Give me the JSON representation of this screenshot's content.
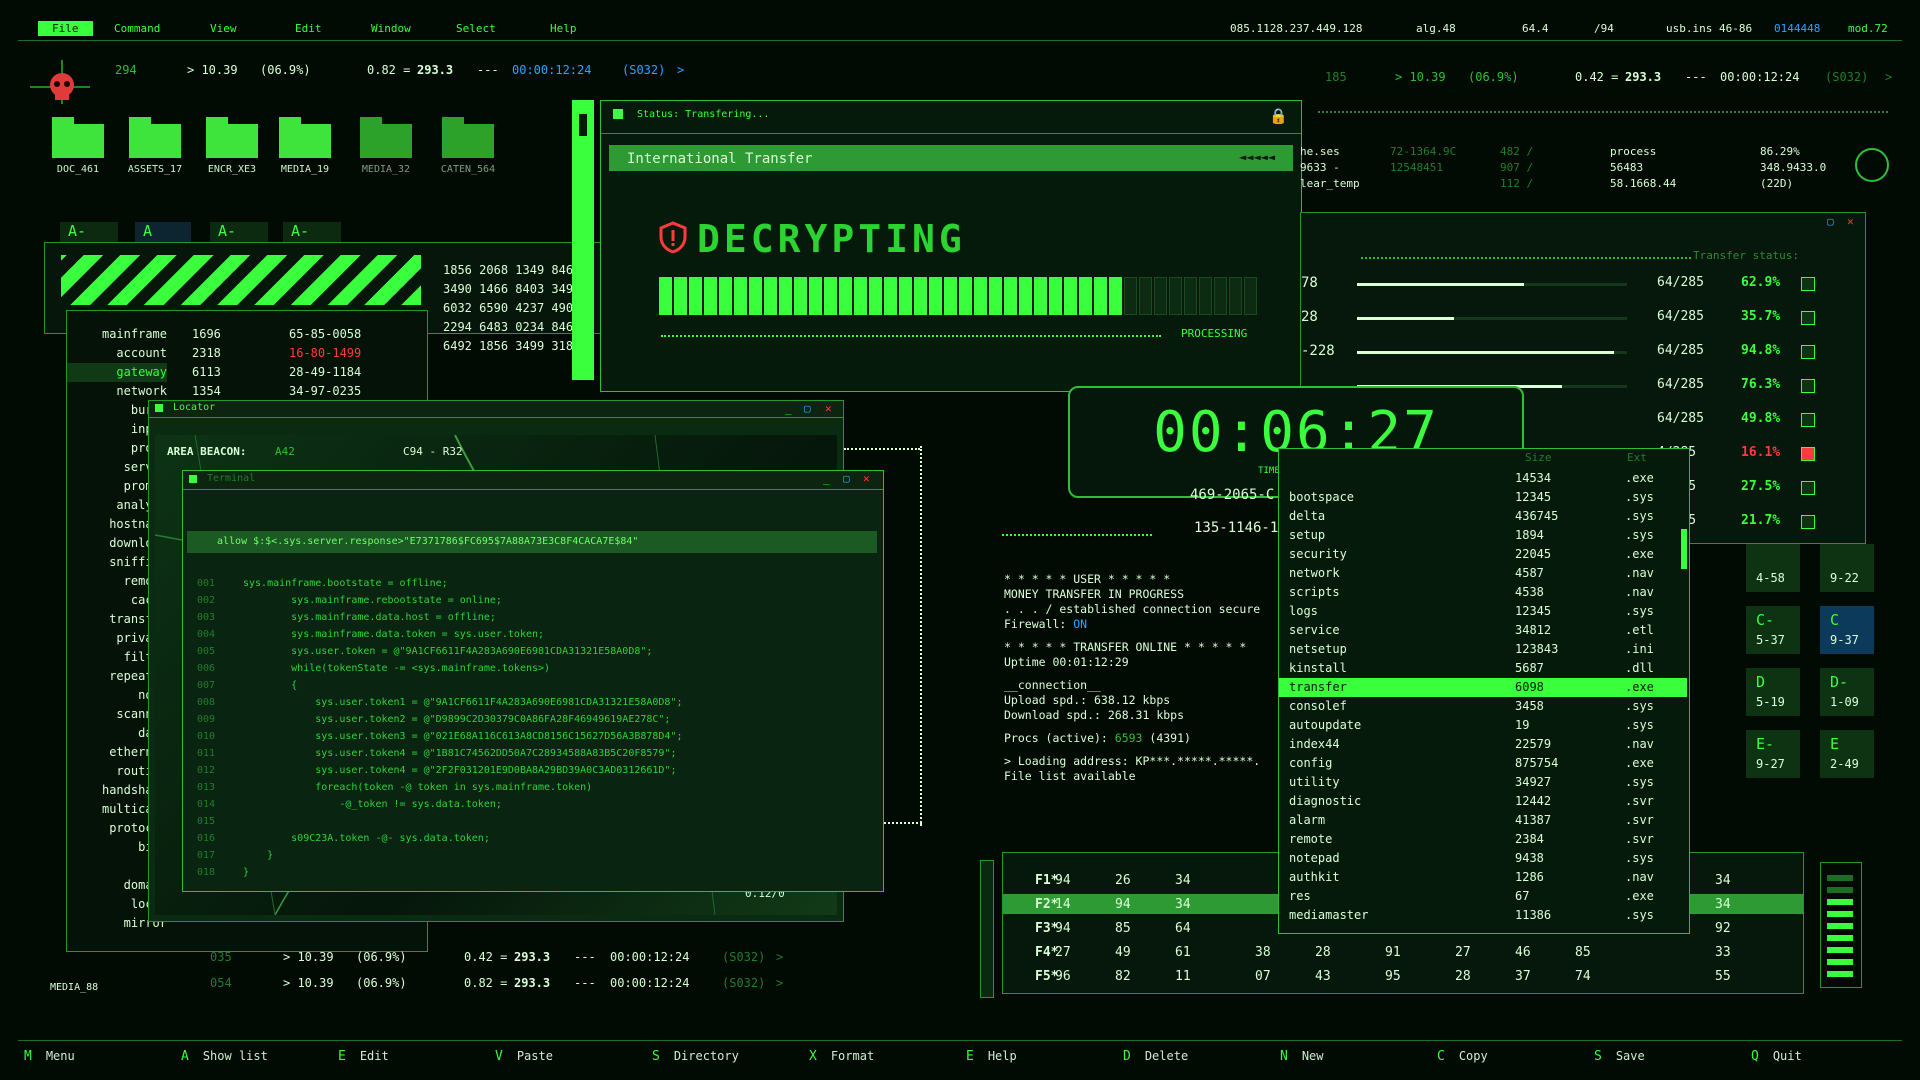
{
  "menubar": {
    "items": [
      "File",
      "Command",
      "View",
      "Edit",
      "Window",
      "Select",
      "Help"
    ],
    "right": [
      "085.1128.237.449.128",
      "alg.48",
      "64.4",
      "/94",
      "usb.ins 46-86",
      "0144448",
      "mod.72"
    ]
  },
  "header_left": {
    "num": "294",
    "val1": "> 10.39",
    "val2": "(06.9%)",
    "eq": "0.82 =",
    "eqval": "293.3",
    "sep": "---",
    "time": "00:00:12:24",
    "code": "(S032)",
    "arrow": ">"
  },
  "header_right": {
    "num": "185",
    "val1": "> 10.39",
    "val2": "(06.9%)",
    "eq": "0.42 =",
    "eqval": "293.3",
    "sep": "---",
    "time": "00:00:12:24",
    "code": "(S032)",
    "arrow": ">"
  },
  "folders": [
    "DOC_461",
    "ASSETS_17",
    "ENCR_XE3",
    "MEDIA_19",
    "MEDIA_32",
    "CATEN_564"
  ],
  "tabs": [
    "A-",
    "A",
    "A-",
    "A-"
  ],
  "numgrid": {
    "rows": [
      [
        "1856",
        "2068",
        "1349",
        "8460"
      ],
      [
        "3490",
        "1466",
        "8403",
        "3499"
      ],
      [
        "6032",
        "6590",
        "4237",
        "4903"
      ],
      [
        "2294",
        "6483",
        "0234",
        "8469"
      ],
      [
        "6492",
        "1856",
        "3499",
        "318"
      ]
    ]
  },
  "process_list": {
    "names": [
      "mainframe",
      "account",
      "gateway",
      "network",
      "burst",
      "input",
      "proxy",
      "server",
      "prompt",
      "analyze",
      "hostname",
      "download",
      "sniffing",
      "remote",
      "cache",
      "transfer",
      "privacy",
      "filter",
      "repeater",
      "node",
      "scanner",
      "data",
      "ethernet",
      "routing",
      "handshake",
      "multicast",
      "protocol",
      "bind",
      "ip",
      "domain",
      "local",
      "mirror"
    ],
    "col2": [
      "1696",
      "2318",
      "6113",
      "1354"
    ],
    "col3": [
      "65-85-0058",
      "16-80-1499",
      "28-49-1184",
      "34-97-0235"
    ]
  },
  "locator": {
    "title": "Locator",
    "beacon": "AREA BEACON:",
    "beacon_val": "A42",
    "coords": "C94 - R32",
    "foot": "0.12/0"
  },
  "terminal": {
    "title": "Terminal",
    "command": "allow $:$<.sys.server.response>\"E7371786$FC695$7A88A73E3C8F4CACA7E$84\"",
    "lines": [
      {
        "n": "001",
        "t": "sys.mainframe.bootstate = offline;"
      },
      {
        "n": "002",
        "t": "        sys.mainframe.rebootstate = online;"
      },
      {
        "n": "003",
        "t": "        sys.mainframe.data.host = offline;"
      },
      {
        "n": "004",
        "t": "        sys.mainframe.data.token = sys.user.token;"
      },
      {
        "n": "005",
        "t": "        sys.user.token = @\"9A1CF6611F4A283A690E6981CDA31321E58A0D8\";"
      },
      {
        "n": "006",
        "t": "        while(tokenState -= <sys.mainframe.tokens>)"
      },
      {
        "n": "007",
        "t": "        {"
      },
      {
        "n": "008",
        "t": "            sys.user.token1 = @\"9A1CF6611F4A283A690E6981CDA31321E58A0D8\";"
      },
      {
        "n": "009",
        "t": "            sys.user.token2 = @\"D9899C2D30379C0A86FA28F46949619AE278C\";"
      },
      {
        "n": "010",
        "t": "            sys.user.token3 = @\"021E68A116C613A8CD8156C15627D56A3B878D4\";"
      },
      {
        "n": "011",
        "t": "            sys.user.token4 = @\"1B81C74562DD50A7C28934588A83B5C20F8579\";"
      },
      {
        "n": "012",
        "t": "            sys.user.token4 = @\"2F2F031201E9D0BA8A29BD39A0C3AD0312661D\";"
      },
      {
        "n": "013",
        "t": "            foreach(token -@ token in sys.mainframe.token)"
      },
      {
        "n": "014",
        "t": "                -@_token != sys.data.token;"
      },
      {
        "n": "015",
        "t": ""
      },
      {
        "n": "016",
        "t": "        s09C23A.token -@- sys.data.token;"
      },
      {
        "n": "017",
        "t": "    }"
      },
      {
        "n": "018",
        "t": "}"
      }
    ]
  },
  "transfer_window": {
    "status": "Status: Transfering...",
    "title": "International Transfer",
    "arrows": "◄◄◄◄◄",
    "decrypting": "DECRYPTING",
    "progress": 0.77,
    "processing": "PROCESSING"
  },
  "timer": {
    "time": "00:06:27",
    "label": "TIME REMAINING"
  },
  "topright_info": {
    "c1": [
      "he.ses",
      "9633 -",
      "lear_temp"
    ],
    "c2": [
      "72-1364.9C",
      "12548451",
      ""
    ],
    "c3": [
      "482 /",
      "907 /",
      "112 /"
    ],
    "c4": [
      "process",
      "56483",
      "58.1668.44"
    ],
    "c5": [
      "86.29%",
      "348.9433.0",
      "(22D)"
    ]
  },
  "transfer_status": {
    "header": "Transfer status:",
    "left": [
      "78",
      "28",
      "-228",
      "",
      "",
      "",
      "",
      ""
    ],
    "rows": [
      {
        "ratio": "64/285",
        "pct": "62.9%",
        "red": false,
        "fill": 0.62
      },
      {
        "ratio": "64/285",
        "pct": "35.7%",
        "red": false,
        "fill": 0.36
      },
      {
        "ratio": "64/285",
        "pct": "94.8%",
        "red": false,
        "fill": 0.95
      },
      {
        "ratio": "64/285",
        "pct": "76.3%",
        "red": false,
        "fill": 0.76
      },
      {
        "ratio": "64/285",
        "pct": "49.8%",
        "red": false,
        "fill": 0.5
      },
      {
        "ratio": "4/285",
        "pct": "16.1%",
        "red": true,
        "fill": 0.16
      },
      {
        "ratio": "4/285",
        "pct": "27.5%",
        "red": false,
        "fill": 0.27
      },
      {
        "ratio": "4/285",
        "pct": "21.7%",
        "red": false,
        "fill": 0.22
      }
    ]
  },
  "ids": [
    "469-2065-C",
    "135-1146-1"
  ],
  "console": {
    "l1": "* * * * *  USER  * * * * *",
    "l2": "MONEY TRANSFER IN PROGRESS",
    "l3": ". . . / established connection secure",
    "l4a": "Firewall: ",
    "l4b": "ON",
    "l5": "* * * * * TRANSFER ONLINE * * * * *",
    "l6": "Uptime 00:01:12:29",
    "l7": "__connection__",
    "l8": "Upload spd.: 638.12 kbps",
    "l9": "Download spd.: 268.31 kbps",
    "l10a": "Procs (active): ",
    "l10b": "6593",
    "l10c": " (4391)",
    "l11": "> Loading address: KP***.*****.*****.",
    "l12": "File list available"
  },
  "filelist": {
    "hdr_size": "Size",
    "hdr_ext": "Ext",
    "rows": [
      {
        "name": "",
        "size": "14534",
        "ext": ".exe"
      },
      {
        "name": "bootspace",
        "size": "12345",
        "ext": ".sys"
      },
      {
        "name": "delta",
        "size": "436745",
        "ext": ".sys"
      },
      {
        "name": "setup",
        "size": "1894",
        "ext": ".sys"
      },
      {
        "name": "security",
        "size": "22045",
        "ext": ".exe"
      },
      {
        "name": "network",
        "size": "4587",
        "ext": ".nav"
      },
      {
        "name": "scripts",
        "size": "4538",
        "ext": ".nav"
      },
      {
        "name": "logs",
        "size": "12345",
        "ext": ".sys"
      },
      {
        "name": "service",
        "size": "34812",
        "ext": ".etl"
      },
      {
        "name": "netsetup",
        "size": "123843",
        "ext": ".ini"
      },
      {
        "name": "kinstall",
        "size": "5687",
        "ext": ".dll"
      },
      {
        "name": "transfer",
        "size": "6098",
        "ext": ".exe"
      },
      {
        "name": "consolef",
        "size": "3458",
        "ext": ".sys"
      },
      {
        "name": "autoupdate",
        "size": "19",
        "ext": ".sys"
      },
      {
        "name": "index44",
        "size": "22579",
        "ext": ".nav"
      },
      {
        "name": "config",
        "size": "875754",
        "ext": ".exe"
      },
      {
        "name": "utility",
        "size": "34927",
        "ext": ".sys"
      },
      {
        "name": "diagnostic",
        "size": "12442",
        "ext": ".svr"
      },
      {
        "name": "alarm",
        "size": "41387",
        "ext": ".svr"
      },
      {
        "name": "remote",
        "size": "2384",
        "ext": ".svr"
      },
      {
        "name": "notepad",
        "size": "9438",
        "ext": ".sys"
      },
      {
        "name": "authkit",
        "size": "1286",
        "ext": ".nav"
      },
      {
        "name": "res",
        "size": "67",
        "ext": ".exe"
      },
      {
        "name": "mediamaster",
        "size": "11386",
        "ext": ".sys"
      }
    ],
    "selected": 11
  },
  "fkeys": [
    {
      "k": "F1*",
      "v": [
        "94",
        "26",
        "34",
        "",
        "",
        "",
        "",
        "",
        "",
        "",
        "",
        "34"
      ]
    },
    {
      "k": "F2*",
      "v": [
        "14",
        "94",
        "34",
        "",
        "",
        "",
        "",
        "",
        "",
        "",
        "",
        "34"
      ]
    },
    {
      "k": "F3*",
      "v": [
        "94",
        "85",
        "64",
        "",
        "",
        "",
        "",
        "",
        "",
        "",
        "",
        "92"
      ]
    },
    {
      "k": "F4*",
      "v": [
        "27",
        "49",
        "61",
        "38",
        "28",
        "91",
        "27",
        "46",
        "85",
        "",
        "",
        "33"
      ]
    },
    {
      "k": "F5*",
      "v": [
        "96",
        "82",
        "11",
        "07",
        "43",
        "95",
        "28",
        "37",
        "74",
        "",
        "",
        "55"
      ]
    }
  ],
  "lower_left_rows": [
    {
      "num": "035",
      "val1": "> 10.39",
      "val2": "(06.9%)",
      "eq": "0.42 =",
      "eqval": "293.3",
      "sep": "---",
      "time": "00:00:12:24",
      "code": "(S032)",
      "arrow": ">"
    },
    {
      "num": "054",
      "val1": "> 10.39",
      "val2": "(06.9%)",
      "eq": "0.82 =",
      "eqval": "293.3",
      "sep": "---",
      "time": "00:00:12:24",
      "code": "(S032)",
      "arrow": ">"
    }
  ],
  "media_label": "MEDIA_88",
  "sideboxes": [
    {
      "a": "",
      "b": "4-58"
    },
    {
      "a": "",
      "b": "9-22"
    },
    {
      "a": "C-",
      "b": "5-37"
    },
    {
      "a": "C",
      "b": "9-37"
    },
    {
      "a": "D",
      "b": "5-19"
    },
    {
      "a": "D-",
      "b": "1-09"
    },
    {
      "a": "E-",
      "b": "9-27"
    },
    {
      "a": "E",
      "b": "2-49"
    }
  ],
  "bottombar": [
    {
      "k": "M",
      "t": "Menu"
    },
    {
      "k": "A",
      "t": "Show list"
    },
    {
      "k": "E",
      "t": "Edit"
    },
    {
      "k": "V",
      "t": "Paste"
    },
    {
      "k": "S",
      "t": "Directory"
    },
    {
      "k": "X",
      "t": "Format"
    },
    {
      "k": "E",
      "t": "Help"
    },
    {
      "k": "D",
      "t": "Delete"
    },
    {
      "k": "N",
      "t": "New"
    },
    {
      "k": "C",
      "t": "Copy"
    },
    {
      "k": "S",
      "t": "Save"
    },
    {
      "k": "Q",
      "t": "Quit"
    }
  ],
  "colors": {
    "accent": "#39ff3c",
    "bg": "#020a04",
    "alert": "#ff3b3b",
    "info": "#2aa4ff"
  }
}
